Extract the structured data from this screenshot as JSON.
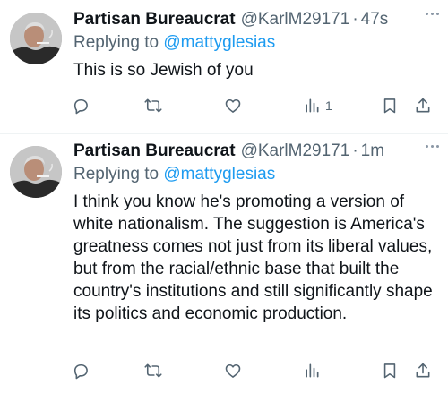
{
  "tweets": [
    {
      "author_name": "Partisan Bureaucrat",
      "handle": "@KarlM29171",
      "separator": "·",
      "time": "47s",
      "replying_prefix": "Replying to ",
      "replying_to": "@mattyglesias",
      "text": "This is so Jewish of you",
      "views_count": "1"
    },
    {
      "author_name": "Partisan Bureaucrat",
      "handle": "@KarlM29171",
      "separator": "·",
      "time": "1m",
      "replying_prefix": "Replying to ",
      "replying_to": "@mattyglesias",
      "text": "I think you know he's promoting a version of white nationalism. The suggestion is America's greatness comes not just from its liberal values, but from the racial/ethnic base that built the country's institutions and still significantly shape its politics and economic production.",
      "views_count": ""
    }
  ],
  "icons": {
    "reply": "reply-icon",
    "retweet": "retweet-icon",
    "like": "like-icon",
    "views": "views-icon",
    "bookmark": "bookmark-icon",
    "share": "share-icon",
    "more": "more-icon"
  },
  "colors": {
    "text": "#0f1419",
    "secondary": "#536471",
    "link": "#1d9bf0",
    "divider": "#eff3f4"
  }
}
